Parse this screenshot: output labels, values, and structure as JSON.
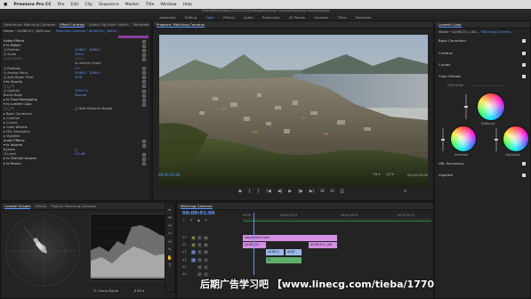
{
  "menubar": {
    "apple": "",
    "app": "Premiere Pro CC",
    "items": [
      "File",
      "Edit",
      "Clip",
      "Sequence",
      "Marker",
      "Title",
      "Window",
      "Help"
    ]
  },
  "app_title": "/Users/Mill/Desktop/2017/04/15/FootageMatching Cameras/Matching Cameras.prproj",
  "workspaces": [
    {
      "label": "Assembly",
      "active": false
    },
    {
      "label": "Editing",
      "active": false
    },
    {
      "label": "Color",
      "active": true
    },
    {
      "label": "Effects",
      "active": false
    },
    {
      "label": "Audio",
      "active": false
    },
    {
      "label": "Production",
      "active": false
    },
    {
      "label": "All Panels",
      "active": false
    },
    {
      "label": "Libraries",
      "active": false
    },
    {
      "label": "Titles",
      "active": false
    },
    {
      "label": "Metadata",
      "active": false
    }
  ],
  "effect_controls": {
    "tabs": [
      "Reference: Matching Cameras",
      "Effect Controls",
      "Audio Clip Mixer: Match",
      "Metadata"
    ],
    "source_line": "Master * A038C511_180F.mov",
    "clip_line": "Matching Cameras * A038C511_18001...",
    "rows": [
      {
        "label": "Video Effects",
        "type": "hdr"
      },
      {
        "label": "▾ fx  Motion",
        "type": "hdr"
      },
      {
        "label": "      ◷ Position",
        "v1": "2048.0",
        "v2": "1080.0"
      },
      {
        "label": "      ◷ Scale",
        "v1": "100.0"
      },
      {
        "label": "        Scale Width",
        "v1": "100.0",
        "dimmed": true
      },
      {
        "label": "",
        "check": "☑ Uniform Scale"
      },
      {
        "label": "      ◷ Rotation",
        "v1": "0.0"
      },
      {
        "label": "      ◷ Anchor Point",
        "v1": "2048.0",
        "v2": "1080.0"
      },
      {
        "label": "      ◷ Anti-flicker Filter",
        "v1": "0.00"
      },
      {
        "label": "▾ fx  Opacity",
        "type": "hdr"
      },
      {
        "label": "      ○ □ ✎",
        "v1": ""
      },
      {
        "label": "      ◷ Opacity",
        "v1": "100.0 %"
      },
      {
        "label": "        Blend Mode",
        "v1": "Normal"
      },
      {
        "label": "▸ fx  Time Remapping",
        "type": "hdr"
      },
      {
        "label": "▾ fx  Lumetri Color",
        "type": "hdr"
      },
      {
        "label": "      ○ □ ✎",
        "check": "□ High Dynamic Range"
      },
      {
        "label": "▸ Basic Correction"
      },
      {
        "label": "▸ Creative"
      },
      {
        "label": "▸ Curves"
      },
      {
        "label": "▸ Color Wheels"
      },
      {
        "label": "▸ HSL Secondary"
      },
      {
        "label": "▸ Vignette"
      },
      {
        "label": "Audio Effects",
        "type": "hdr"
      },
      {
        "label": "▾ fx  Volume",
        "type": "hdr"
      },
      {
        "label": "        Bypass",
        "check": "□"
      },
      {
        "label": "      ◷ Level",
        "v1": "0.0 dB"
      },
      {
        "label": "▸ fx  Channel Volume",
        "type": "hdr"
      },
      {
        "label": "▸ fx  Panner",
        "type": "hdr"
      }
    ],
    "timecode": "00:00:01:00"
  },
  "scopes": {
    "tabs": [
      "Lumetri Scopes",
      "Effects",
      "Project: Matching Cameras"
    ],
    "clamp_label": "Clamp Signal",
    "bit_depth": "8 Bit"
  },
  "tools": [
    "▸",
    "⇹",
    "↔",
    "✂",
    "⇔",
    "✎",
    "✋",
    "T"
  ],
  "program": {
    "tab": "Program: Matching Cameras",
    "timecode": "00:00:01:00",
    "fit": "Fit",
    "zoom": "1/2",
    "duration": "00:00:05:00",
    "transport": [
      "◆",
      "{",
      "}",
      "|◀",
      "◀|",
      "▶",
      "|▶",
      "▶|",
      "⊞",
      "⊟",
      "⎙",
      "+"
    ]
  },
  "timeline": {
    "tab": "Matching Cameras",
    "timecode": "00:00:01:00",
    "ruler": [
      "00:00",
      "00:00:04:23",
      "00:00:09:23",
      "00:00:14:23"
    ],
    "tracks": [
      {
        "name": "V3"
      },
      {
        "name": "V2"
      },
      {
        "name": "V1"
      },
      {
        "name": "A1"
      },
      {
        "name": "A2"
      },
      {
        "name": "A3"
      }
    ],
    "clips": {
      "adjustment": "Adjustment Layer",
      "v2a": "A038C511",
      "v2b": "A038C511_180",
      "v1a": "A038C5",
      "v1b": "A038",
      "a1": "fx"
    }
  },
  "watermark": "后期广告学习吧 【www.linecg.com/tieba/1770】",
  "lumetri": {
    "tab": "Lumetri Color",
    "source_line": "Master * A038C511_180...",
    "clip_line": "Matching Cameras...",
    "sections": [
      {
        "label": "Basic Correction",
        "checked": true
      },
      {
        "label": "Creative",
        "checked": true
      },
      {
        "label": "Curves",
        "checked": true
      },
      {
        "label": "Color Wheels",
        "checked": true
      }
    ],
    "hdr_white": "HDR White",
    "wheels": {
      "midtones": "Midtones",
      "shadows": "Shadows",
      "highlights": "Highlights"
    },
    "bottom_sections": [
      {
        "label": "HSL Secondary",
        "checked": true
      },
      {
        "label": "Vignette",
        "checked": true
      }
    ]
  }
}
